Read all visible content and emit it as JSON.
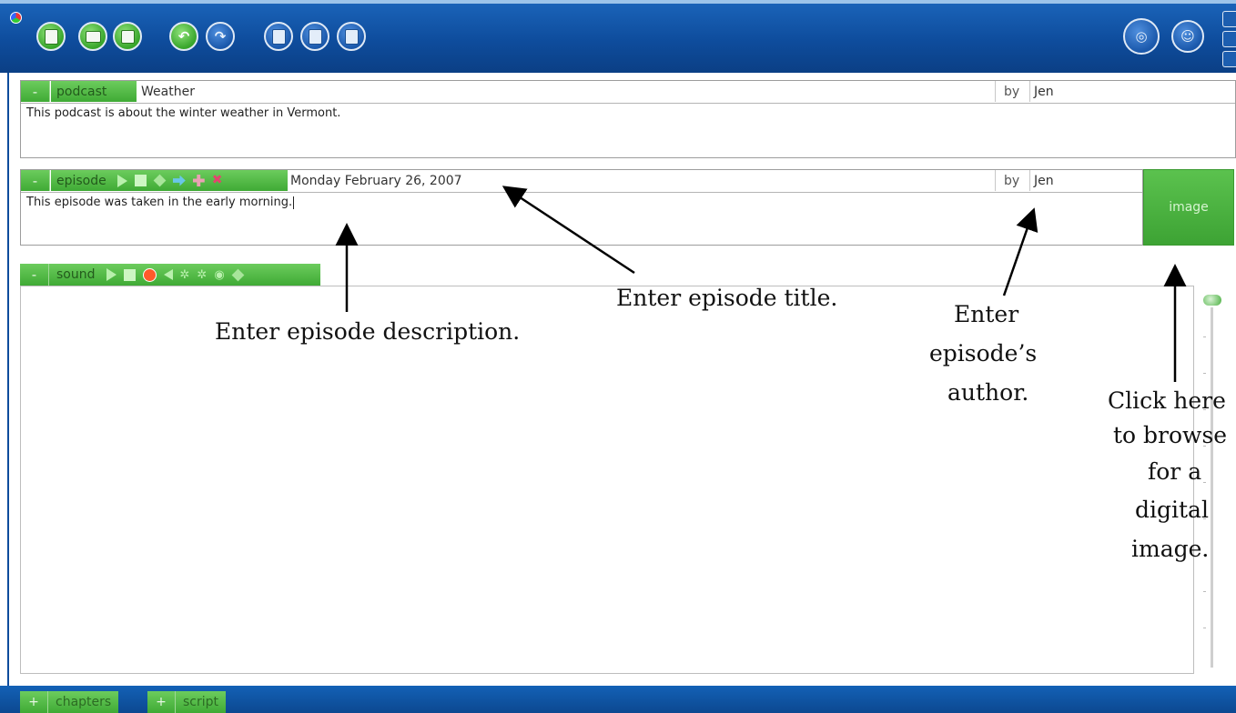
{
  "toolbar": {
    "buttons": [
      {
        "name": "new-file-icon",
        "color": "green"
      },
      {
        "name": "open-folder-icon",
        "color": "green"
      },
      {
        "name": "save-icon",
        "color": "green"
      },
      {
        "name": "undo-icon",
        "color": "green"
      },
      {
        "name": "redo-icon",
        "color": "blue"
      },
      {
        "name": "cut-icon",
        "color": "blue"
      },
      {
        "name": "copy-icon",
        "color": "blue"
      },
      {
        "name": "paste-icon",
        "color": "blue"
      },
      {
        "name": "broadcast-icon",
        "color": "blue"
      },
      {
        "name": "users-icon",
        "color": "blue"
      }
    ]
  },
  "podcast": {
    "toggle": "-",
    "tab_label": "podcast",
    "title": "Weather",
    "by_label": "by",
    "author": "Jen",
    "description": "This podcast is about the winter weather in Vermont."
  },
  "episode": {
    "toggle": "-",
    "tab_label": "episode",
    "title": "Monday February 26, 2007",
    "by_label": "by",
    "author": "Jen",
    "description": "This episode was taken in the early morning.",
    "image_button": "image"
  },
  "sound": {
    "toggle": "-",
    "tab_label": "sound"
  },
  "bottom_tabs": [
    {
      "toggle": "+",
      "label": "chapters"
    },
    {
      "toggle": "+",
      "label": "script"
    }
  ],
  "annotations": {
    "title_note": "Enter episode title.",
    "description_note": "Enter episode description.",
    "author_note_1": "Enter",
    "author_note_2": "episode’s",
    "author_note_3": "author.",
    "image_note_1": "Click here",
    "image_note_2": "to browse",
    "image_note_3": "for a",
    "image_note_4": "digital",
    "image_note_5": "image."
  },
  "colors": {
    "accent_green": "#4cb841",
    "toolbar_blue": "#0e4c9c"
  }
}
